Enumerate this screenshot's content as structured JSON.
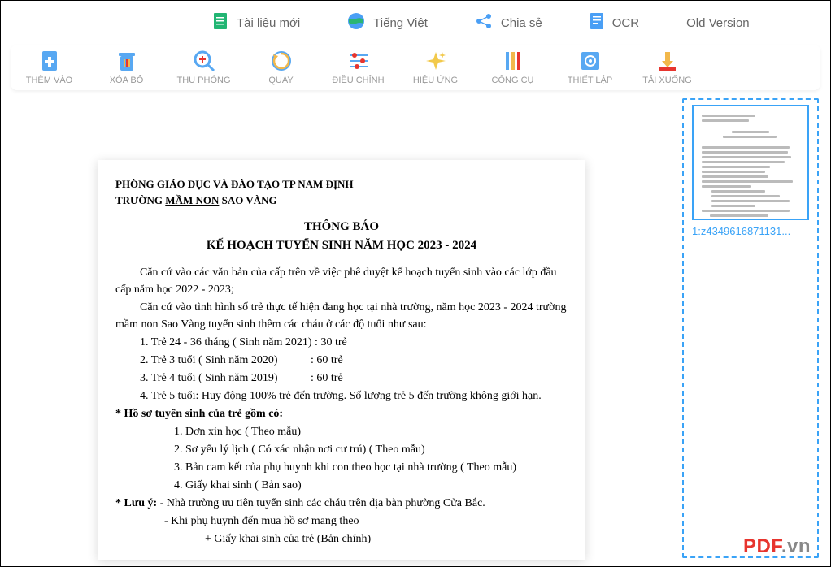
{
  "topMenu": {
    "newDoc": "Tài liệu mới",
    "language": "Tiếng Việt",
    "share": "Chia sẻ",
    "ocr": "OCR",
    "oldVersion": "Old Version"
  },
  "toolbar": {
    "add": "THÊM VÀO",
    "remove": "XÓA BỎ",
    "zoom": "THU PHÓNG",
    "rotate": "QUAY",
    "adjust": "ĐIỀU CHỈNH",
    "effect": "HIỆU ỨNG",
    "tools": "CÔNG CỤ",
    "settings": "THIẾT LẬP",
    "download": "TẢI XUỐNG"
  },
  "document": {
    "header1": "PHÒNG GIÁO DỤC VÀ ĐÀO TẠO TP NAM ĐỊNH",
    "header2_pre": "TRƯỜNG ",
    "header2_mid": "MẦM NON",
    "header2_post": " SAO VÀNG",
    "title": "THÔNG BÁO",
    "subtitle": "KẾ HOẠCH TUYỂN SINH NĂM HỌC 2023 - 2024",
    "p1": "Căn cứ vào các văn bản của cấp trên về việc phê duyệt kế hoạch tuyển sinh vào các lớp đầu cấp năm học 2022 - 2023;",
    "p2": "Căn cứ vào tình hình số trẻ thực tế hiện đang học tại nhà trường, năm học 2023 - 2024 trường mầm non Sao Vàng tuyển sinh thêm các cháu ở các độ tuổi như sau:",
    "li1": "1. Trẻ 24 - 36 tháng ( Sinh năm 2021) : 30 trẻ",
    "li2a": "2. Trẻ 3 tuổi ( Sinh năm 2020)",
    "li2b": ": 60 trẻ",
    "li3a": "3. Trẻ 4 tuổi ( Sinh năm 2019)",
    "li3b": ": 60 trẻ",
    "li4": "4. Trẻ 5 tuổi: Huy động 100% trẻ đến trường. Số lượng trẻ 5 đến trường không giới hạn.",
    "hs1": "* Hồ sơ tuyển sinh của trẻ gồm có:",
    "hs1_1": "1. Đơn xin học ( Theo mẫu)",
    "hs1_2": "2. Sơ yếu lý lịch ( Có xác nhận nơi cư trú)  ( Theo mẫu)",
    "hs1_3": "3. Bản cam kết của phụ huynh khi con theo học tại nhà trường ( Theo mẫu)",
    "hs1_4": "4. Giấy khai sinh ( Bản sao)",
    "note_label": "* Lưu ý:",
    "note_text": " - Nhà trường ưu tiên tuyển sinh các cháu trên địa bàn phường Cửa Bắc.",
    "note2": "- Khi phụ huynh đến mua hồ sơ mang theo",
    "note3": "+ Giấy khai sinh của trẻ (Bản chính)"
  },
  "sidebar": {
    "thumbLabel": "1:z4349616871131..."
  },
  "watermark": {
    "pdf": "PDF",
    "vn": ".vn"
  }
}
